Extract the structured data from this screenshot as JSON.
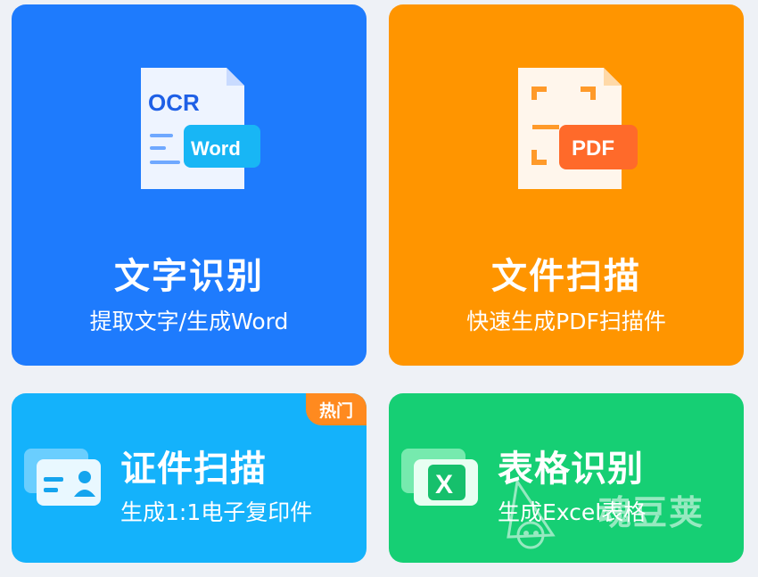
{
  "cards": {
    "ocr": {
      "title": "文字识别",
      "subtitle": "提取文字/生成Word",
      "icon": "ocr-to-word-icon",
      "icon_text_top": "OCR",
      "icon_text_tag": "Word",
      "color": "#1e7bfd"
    },
    "scan": {
      "title": "文件扫描",
      "subtitle": "快速生成PDF扫描件",
      "icon": "pdf-scan-icon",
      "icon_text_tag": "PDF",
      "color": "#ff9500"
    },
    "id": {
      "title": "证件扫描",
      "subtitle": "生成1:1电子复印件",
      "badge": "热门",
      "icon": "id-card-icon",
      "color": "#14b2fb"
    },
    "table": {
      "title": "表格识别",
      "subtitle": "生成Excel表格",
      "icon": "excel-icon",
      "icon_text_tag": "X",
      "color": "#16cf74"
    }
  },
  "watermark": {
    "text": "魂豆荚",
    "icon": "wandoujia-logo-icon"
  },
  "colors": {
    "badge": "#ff8a1f",
    "background": "#eef1f6"
  }
}
